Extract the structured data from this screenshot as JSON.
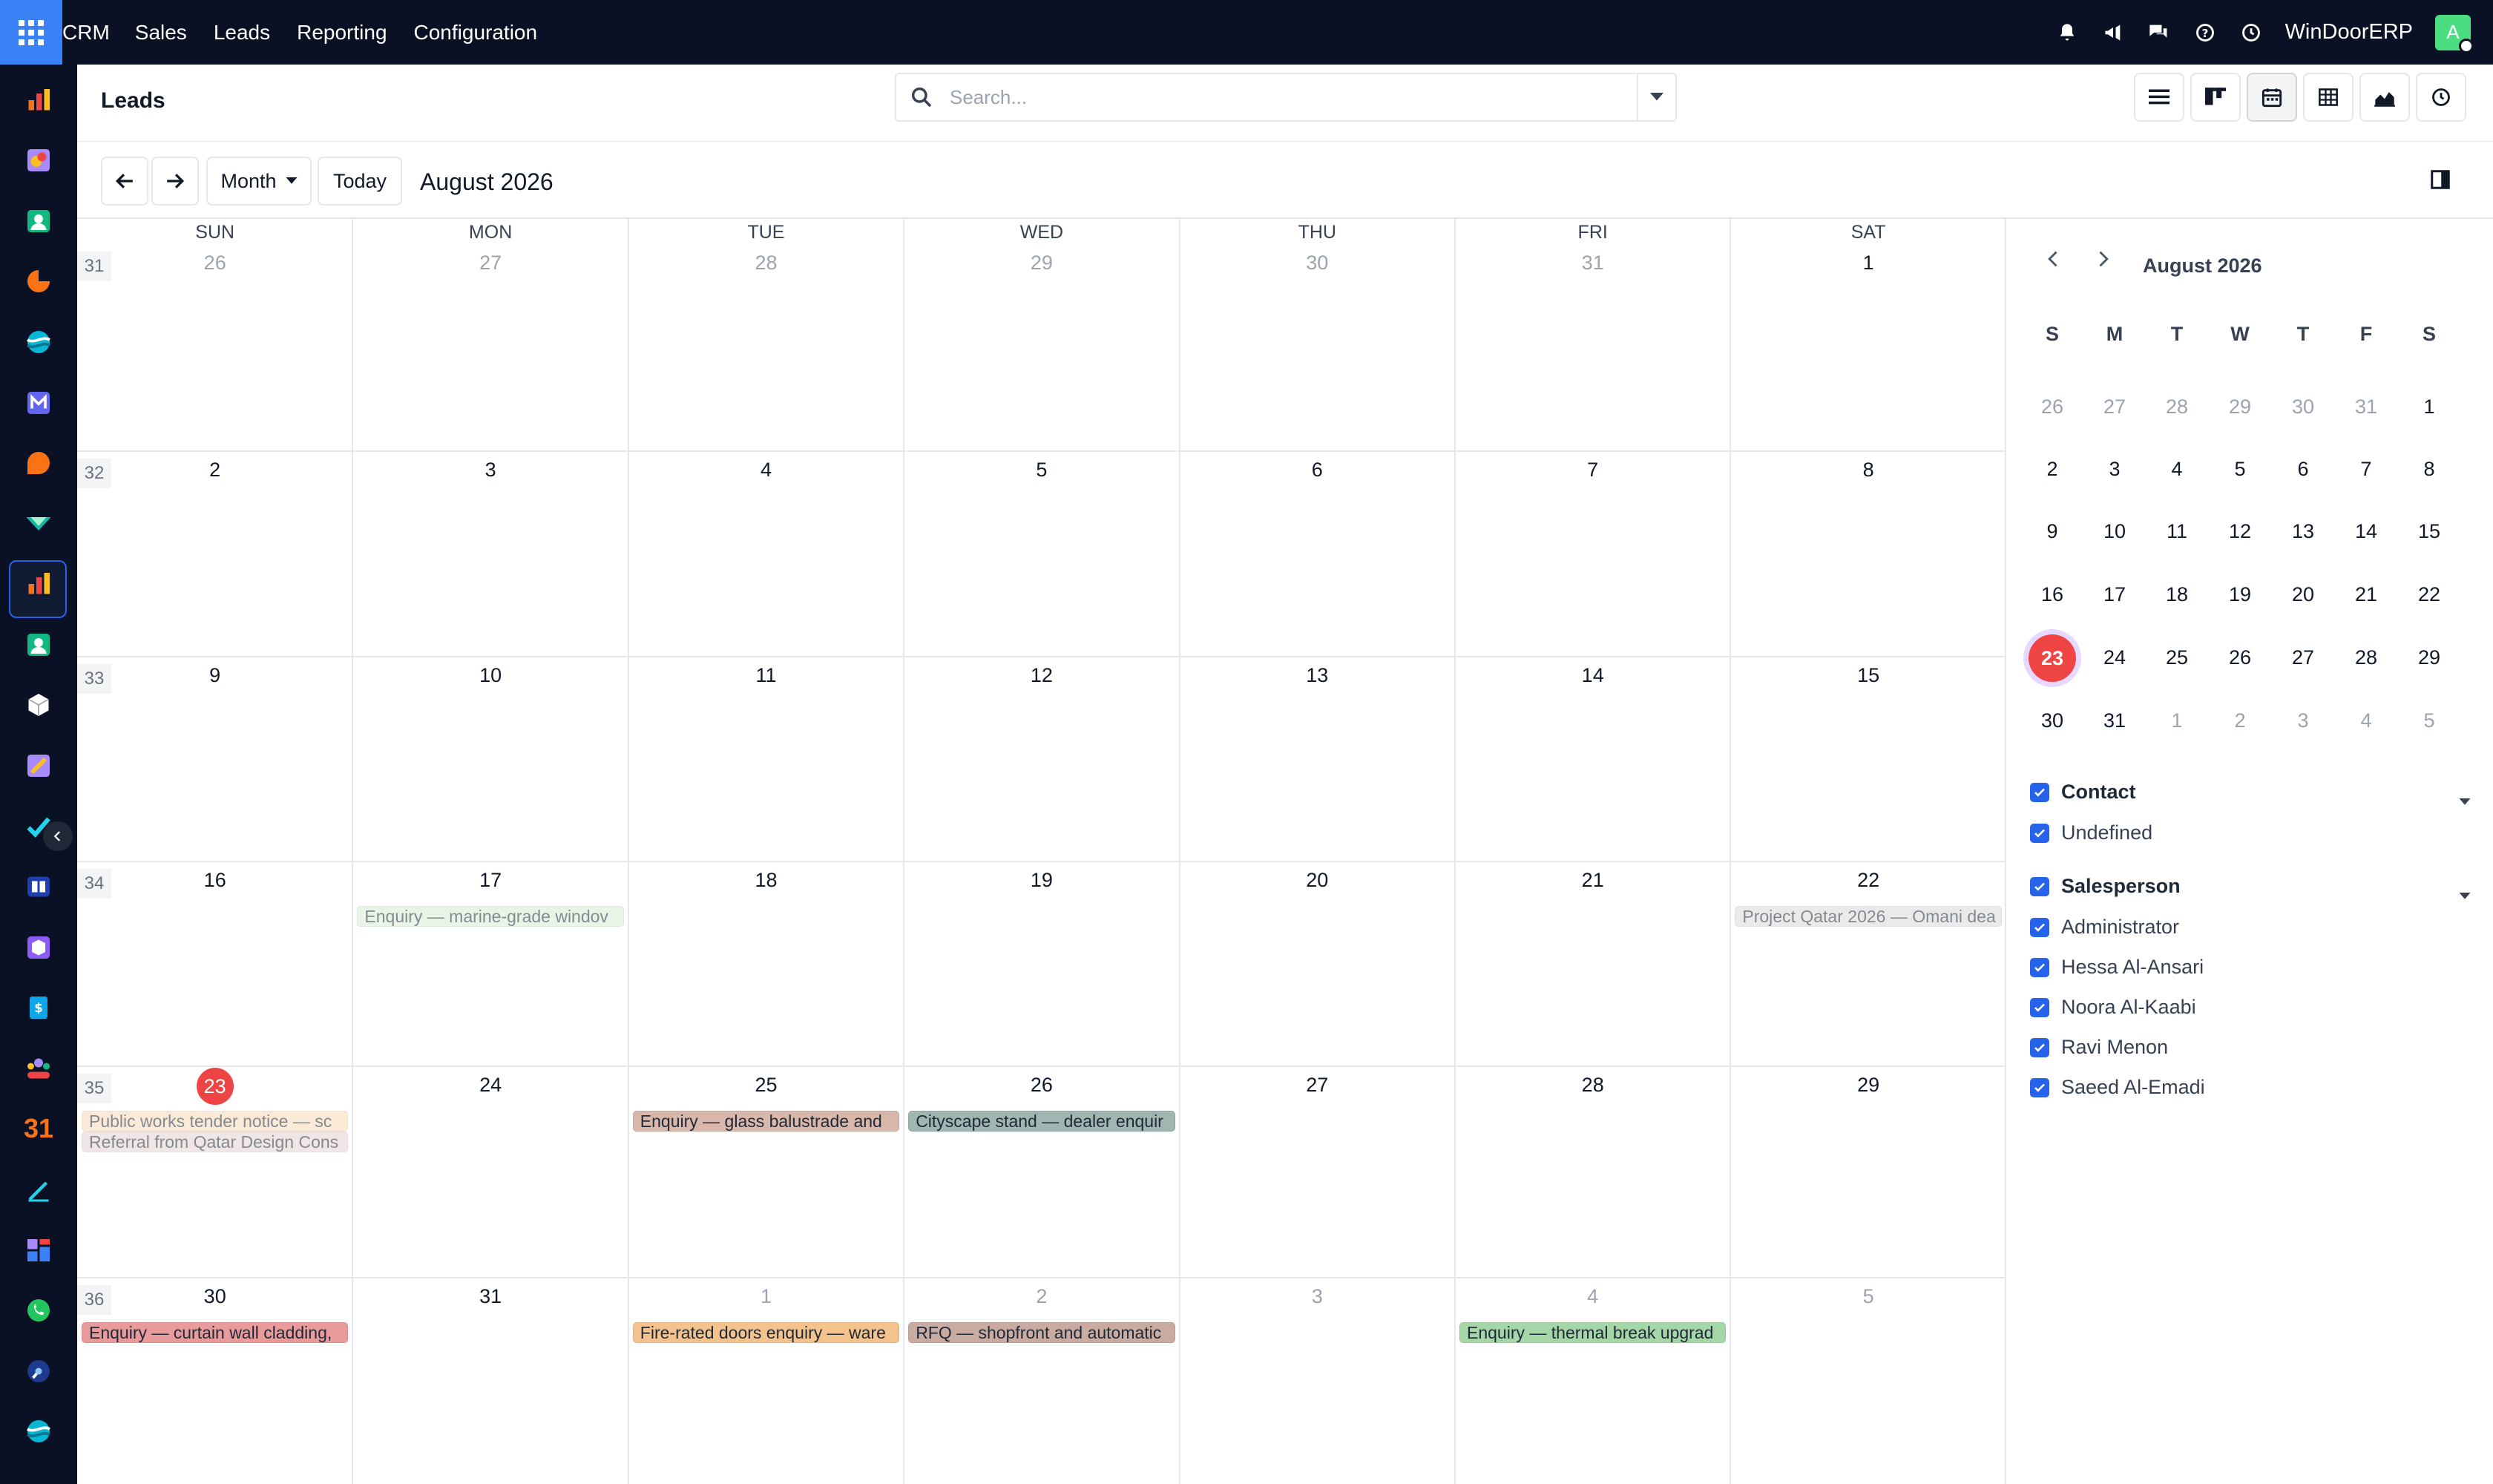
{
  "topbar": {
    "menu": [
      "CRM",
      "Sales",
      "Leads",
      "Reporting",
      "Configuration"
    ],
    "company": "WinDoorERP",
    "avatar_letter": "A",
    "icons": [
      "bell-icon",
      "megaphone-icon",
      "chat-icon",
      "help-icon",
      "clock-icon"
    ]
  },
  "sidebar": {
    "apps": [
      "dashboards-app-icon",
      "discuss-app-icon",
      "contacts-app-icon",
      "crm-app-icon",
      "sales-app-icon",
      "mail-app-icon",
      "chat-app-icon",
      "leads-app-icon",
      "reporting-app-icon",
      "employees-app-icon",
      "inventory-app-icon",
      "design-app-icon",
      "tasks-app-icon",
      "knowledge-app-icon",
      "products-app-icon",
      "invoicing-app-icon",
      "team-app-icon",
      "calendar-app-icon",
      "sign-app-icon",
      "spreadsheet-app-icon",
      "whatsapp-app-icon",
      "planning-app-icon",
      "helpdesk-app-icon"
    ],
    "calendar_label": "31",
    "active_app": "leads-app-icon"
  },
  "control_panel": {
    "title": "Leads",
    "search_placeholder": "Search...",
    "views": [
      "list-view",
      "kanban-view",
      "calendar-view",
      "pivot-view",
      "graph-view",
      "activity-view"
    ],
    "active_view": "calendar-view"
  },
  "calendar_nav": {
    "prev": "←",
    "next": "→",
    "scale": "Month",
    "today": "Today",
    "range_label": "August 2026"
  },
  "calendar": {
    "day_headers": [
      "SUN",
      "MON",
      "TUE",
      "WED",
      "THU",
      "FRI",
      "SAT"
    ],
    "weeks": [
      {
        "week": "31",
        "days": [
          {
            "d": "26",
            "muted": true
          },
          {
            "d": "27",
            "muted": true
          },
          {
            "d": "28",
            "muted": true
          },
          {
            "d": "29",
            "muted": true
          },
          {
            "d": "30",
            "muted": true
          },
          {
            "d": "31",
            "muted": true
          },
          {
            "d": "1",
            "muted": false
          }
        ]
      },
      {
        "week": "32",
        "days": [
          {
            "d": "2",
            "muted": false
          },
          {
            "d": "3",
            "muted": false
          },
          {
            "d": "4",
            "muted": false
          },
          {
            "d": "5",
            "muted": false
          },
          {
            "d": "6",
            "muted": false
          },
          {
            "d": "7",
            "muted": false
          },
          {
            "d": "8",
            "muted": false
          }
        ]
      },
      {
        "week": "33",
        "days": [
          {
            "d": "9",
            "muted": false
          },
          {
            "d": "10",
            "muted": false
          },
          {
            "d": "11",
            "muted": false
          },
          {
            "d": "12",
            "muted": false
          },
          {
            "d": "13",
            "muted": false
          },
          {
            "d": "14",
            "muted": false
          },
          {
            "d": "15",
            "muted": false
          }
        ]
      },
      {
        "week": "34",
        "days": [
          {
            "d": "16",
            "muted": false
          },
          {
            "d": "17",
            "muted": false
          },
          {
            "d": "18",
            "muted": false
          },
          {
            "d": "19",
            "muted": false
          },
          {
            "d": "20",
            "muted": false
          },
          {
            "d": "21",
            "muted": false
          },
          {
            "d": "22",
            "muted": false
          }
        ]
      },
      {
        "week": "35",
        "days": [
          {
            "d": "23",
            "muted": false,
            "today": true
          },
          {
            "d": "24",
            "muted": false
          },
          {
            "d": "25",
            "muted": false
          },
          {
            "d": "26",
            "muted": false
          },
          {
            "d": "27",
            "muted": false
          },
          {
            "d": "28",
            "muted": false
          },
          {
            "d": "29",
            "muted": false
          }
        ]
      },
      {
        "week": "36",
        "days": [
          {
            "d": "30",
            "muted": false
          },
          {
            "d": "31",
            "muted": false
          },
          {
            "d": "1",
            "muted": true
          },
          {
            "d": "2",
            "muted": true
          },
          {
            "d": "3",
            "muted": true
          },
          {
            "d": "4",
            "muted": true
          },
          {
            "d": "5",
            "muted": true
          }
        ]
      }
    ],
    "events": [
      {
        "week": 3,
        "day": 1,
        "slot": 0,
        "label": "Enquiry — marine-grade windov",
        "color": "#d6ecd2",
        "faded": true
      },
      {
        "week": 3,
        "day": 6,
        "slot": 0,
        "label": "Project Qatar 2026 — Omani dea",
        "color": "#d9d9d9",
        "faded": true
      },
      {
        "week": 4,
        "day": 0,
        "slot": 0,
        "label": "Public works tender notice — sc",
        "color": "#f8d9b8",
        "faded": true
      },
      {
        "week": 4,
        "day": 0,
        "slot": 1,
        "label": "Referral from Qatar Design Cons",
        "color": "#e5d3d0",
        "faded": true
      },
      {
        "week": 4,
        "day": 2,
        "slot": 0,
        "label": "Enquiry — glass balustrade and",
        "color": "#d9b8ab",
        "faded": false
      },
      {
        "week": 4,
        "day": 3,
        "slot": 0,
        "label": "Cityscape stand — dealer enquir",
        "color": "#9fb6b1",
        "faded": false
      },
      {
        "week": 5,
        "day": 0,
        "slot": 0,
        "label": "Enquiry — curtain wall cladding,",
        "color": "#e99a9a",
        "faded": false
      },
      {
        "week": 5,
        "day": 2,
        "slot": 0,
        "label": "Fire-rated doors enquiry — ware",
        "color": "#f4c38d",
        "faded": false
      },
      {
        "week": 5,
        "day": 3,
        "slot": 0,
        "label": "RFQ — shopfront and automatic",
        "color": "#c9aba2",
        "faded": false
      },
      {
        "week": 5,
        "day": 5,
        "slot": 0,
        "label": "Enquiry — thermal break upgrad",
        "color": "#a5d6a7",
        "faded": false
      }
    ]
  },
  "mini_calendar": {
    "title": "August 2026",
    "headers": [
      "S",
      "M",
      "T",
      "W",
      "T",
      "F",
      "S"
    ],
    "weeks": [
      [
        {
          "d": "26",
          "m": true
        },
        {
          "d": "27",
          "m": true
        },
        {
          "d": "28",
          "m": true
        },
        {
          "d": "29",
          "m": true
        },
        {
          "d": "30",
          "m": true
        },
        {
          "d": "31",
          "m": true
        },
        {
          "d": "1",
          "m": false
        }
      ],
      [
        {
          "d": "2",
          "m": false
        },
        {
          "d": "3",
          "m": false
        },
        {
          "d": "4",
          "m": false
        },
        {
          "d": "5",
          "m": false
        },
        {
          "d": "6",
          "m": false
        },
        {
          "d": "7",
          "m": false
        },
        {
          "d": "8",
          "m": false
        }
      ],
      [
        {
          "d": "9",
          "m": false
        },
        {
          "d": "10",
          "m": false
        },
        {
          "d": "11",
          "m": false
        },
        {
          "d": "12",
          "m": false
        },
        {
          "d": "13",
          "m": false
        },
        {
          "d": "14",
          "m": false
        },
        {
          "d": "15",
          "m": false
        }
      ],
      [
        {
          "d": "16",
          "m": false
        },
        {
          "d": "17",
          "m": false
        },
        {
          "d": "18",
          "m": false
        },
        {
          "d": "19",
          "m": false
        },
        {
          "d": "20",
          "m": false
        },
        {
          "d": "21",
          "m": false
        },
        {
          "d": "22",
          "m": false
        }
      ],
      [
        {
          "d": "23",
          "m": false,
          "today": true
        },
        {
          "d": "24",
          "m": false
        },
        {
          "d": "25",
          "m": false
        },
        {
          "d": "26",
          "m": false
        },
        {
          "d": "27",
          "m": false
        },
        {
          "d": "28",
          "m": false
        },
        {
          "d": "29",
          "m": false
        }
      ],
      [
        {
          "d": "30",
          "m": false
        },
        {
          "d": "31",
          "m": false
        },
        {
          "d": "1",
          "m": true
        },
        {
          "d": "2",
          "m": true
        },
        {
          "d": "3",
          "m": true
        },
        {
          "d": "4",
          "m": true
        },
        {
          "d": "5",
          "m": true
        }
      ]
    ]
  },
  "filters": {
    "contact": {
      "label": "Contact",
      "items": [
        "Undefined"
      ]
    },
    "salesperson": {
      "label": "Salesperson",
      "items": [
        "Administrator",
        "Hessa Al-Ansari",
        "Noora Al-Kaabi",
        "Ravi Menon",
        "Saeed Al-Emadi"
      ]
    }
  },
  "colors": {
    "accent": "#2563eb",
    "today": "#ef4444",
    "topbar": "#0a1124"
  }
}
